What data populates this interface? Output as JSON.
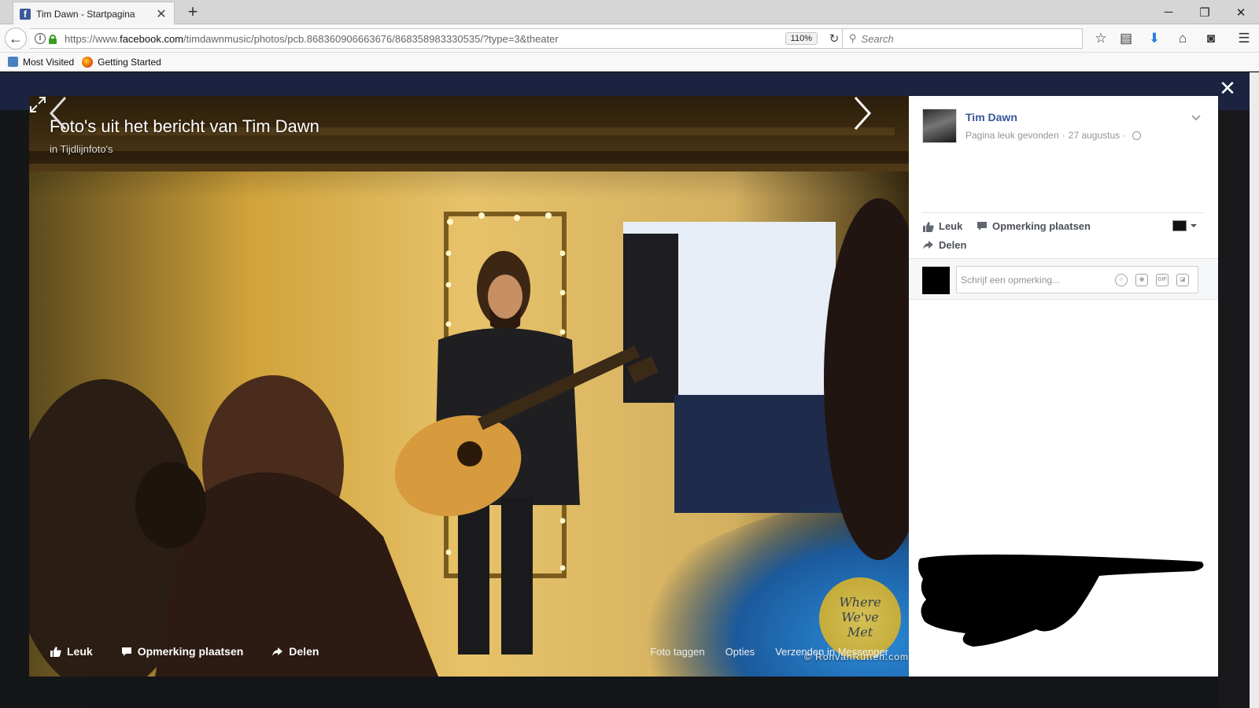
{
  "browser": {
    "tab_title": "Tim Dawn - Startpagina",
    "url_prefix": "https://www.",
    "url_host": "facebook.com",
    "url_path": "/timdawnmusic/photos/pcb.868360906663676/868358983330535/?type=3&theater",
    "zoom": "110%",
    "search_placeholder": "Search",
    "bookmarks": [
      "Most Visited",
      "Getting Started"
    ]
  },
  "photo": {
    "title": "Foto's uit het bericht van Tim Dawn",
    "subtitle_prefix": "in",
    "subtitle_link": "Tijdlijnfoto's",
    "actions": {
      "like": "Leuk",
      "comment": "Opmerking plaatsen",
      "share": "Delen"
    },
    "links": [
      "Foto taggen",
      "Opties",
      "Verzenden in Messenger"
    ],
    "watermark_text": [
      "Where",
      "We've",
      "Met"
    ],
    "watermark_side": "festival",
    "copyright": "© RonvanRutten.com"
  },
  "panel": {
    "poster_name": "Tim Dawn",
    "meta_action": "Pagina leuk gevonden",
    "date": "27 augustus",
    "actions": {
      "like": "Leuk",
      "comment": "Opmerking plaatsen",
      "share": "Delen"
    },
    "comment_placeholder": "Schrijf een opmerking..."
  },
  "colors": {
    "facebook_blue": "#3b5998",
    "link_blue": "#365899",
    "meta_grey": "#90949c",
    "action_grey": "#4b4f56"
  }
}
